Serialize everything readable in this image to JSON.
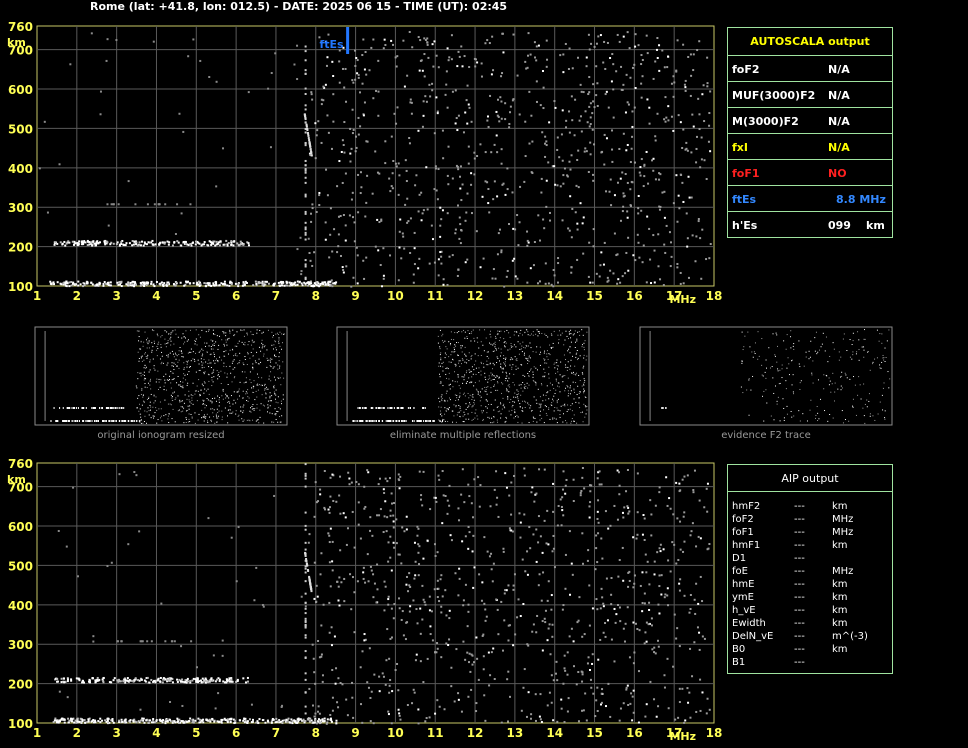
{
  "title": "Rome (lat: +41.8, lon: 012.5) - DATE: 2025 06 15 - TIME (UT): 02:45",
  "colors": {
    "axis": "#ffff55",
    "frame": "#c8c866",
    "grid": "#5a5a5a",
    "table_border": "#9fe39f",
    "trace": "#ffffff",
    "fte_marker": "#2277ff",
    "header_yellow": "#ffff00"
  },
  "ionogram": {
    "x_ticks": [
      "1",
      "2",
      "3",
      "4",
      "5",
      "6",
      "7",
      "8",
      "9",
      "10",
      "11",
      "12",
      "13",
      "14",
      "15",
      "16",
      "17",
      "18"
    ],
    "y_ticks": [
      "760",
      "700",
      "600",
      "500",
      "400",
      "300",
      "200",
      "100"
    ],
    "y_unit": "km",
    "x_unit": "MHz",
    "fte_label": "ftEs"
  },
  "autoscala": {
    "header": "AUTOSCALA output",
    "rows": [
      {
        "key": "foF2",
        "value": "N/A",
        "key_color": "#ffffff",
        "value_color": "#ffffff"
      },
      {
        "key": "MUF(3000)F2",
        "value": "N/A",
        "key_color": "#ffffff",
        "value_color": "#ffffff"
      },
      {
        "key": "M(3000)F2",
        "value": "N/A",
        "key_color": "#ffffff",
        "value_color": "#ffffff"
      },
      {
        "key": "fxI",
        "value": "N/A",
        "key_color": "#ffff00",
        "value_color": "#ffff00"
      },
      {
        "key": "foF1",
        "value": "NO",
        "key_color": "#ff2020",
        "value_color": "#ff2020"
      },
      {
        "key": "ftEs",
        "value": "8.8 MHz",
        "key_color": "#3388ff",
        "value_color": "#3388ff"
      },
      {
        "key": "h'Es",
        "value": "099",
        "unit": "km",
        "key_color": "#ffffff",
        "value_color": "#ffffff"
      }
    ]
  },
  "thumbnails": [
    {
      "caption": "original ionogram resized"
    },
    {
      "caption": "eliminate multiple reflections"
    },
    {
      "caption": "evidence F2 trace"
    }
  ],
  "aip": {
    "header": "AIP output",
    "rows": [
      {
        "key": "hmF2",
        "value": "---",
        "unit": "km"
      },
      {
        "key": "foF2",
        "value": "---",
        "unit": "MHz"
      },
      {
        "key": "foF1",
        "value": "---",
        "unit": "MHz"
      },
      {
        "key": "hmF1",
        "value": "---",
        "unit": "km"
      },
      {
        "key": "D1",
        "value": "---",
        "unit": ""
      },
      {
        "key": "foE",
        "value": "---",
        "unit": "MHz"
      },
      {
        "key": "hmE",
        "value": "---",
        "unit": "km"
      },
      {
        "key": "ymE",
        "value": "---",
        "unit": "km"
      },
      {
        "key": "h_vE",
        "value": "---",
        "unit": "km"
      },
      {
        "key": "Ewidth",
        "value": "---",
        "unit": "km"
      },
      {
        "key": "DelN_vE",
        "value": "---",
        "unit": "m^(-3)"
      },
      {
        "key": "B0",
        "value": "---",
        "unit": "km"
      },
      {
        "key": "B1",
        "value": "---",
        "unit": ""
      }
    ]
  }
}
